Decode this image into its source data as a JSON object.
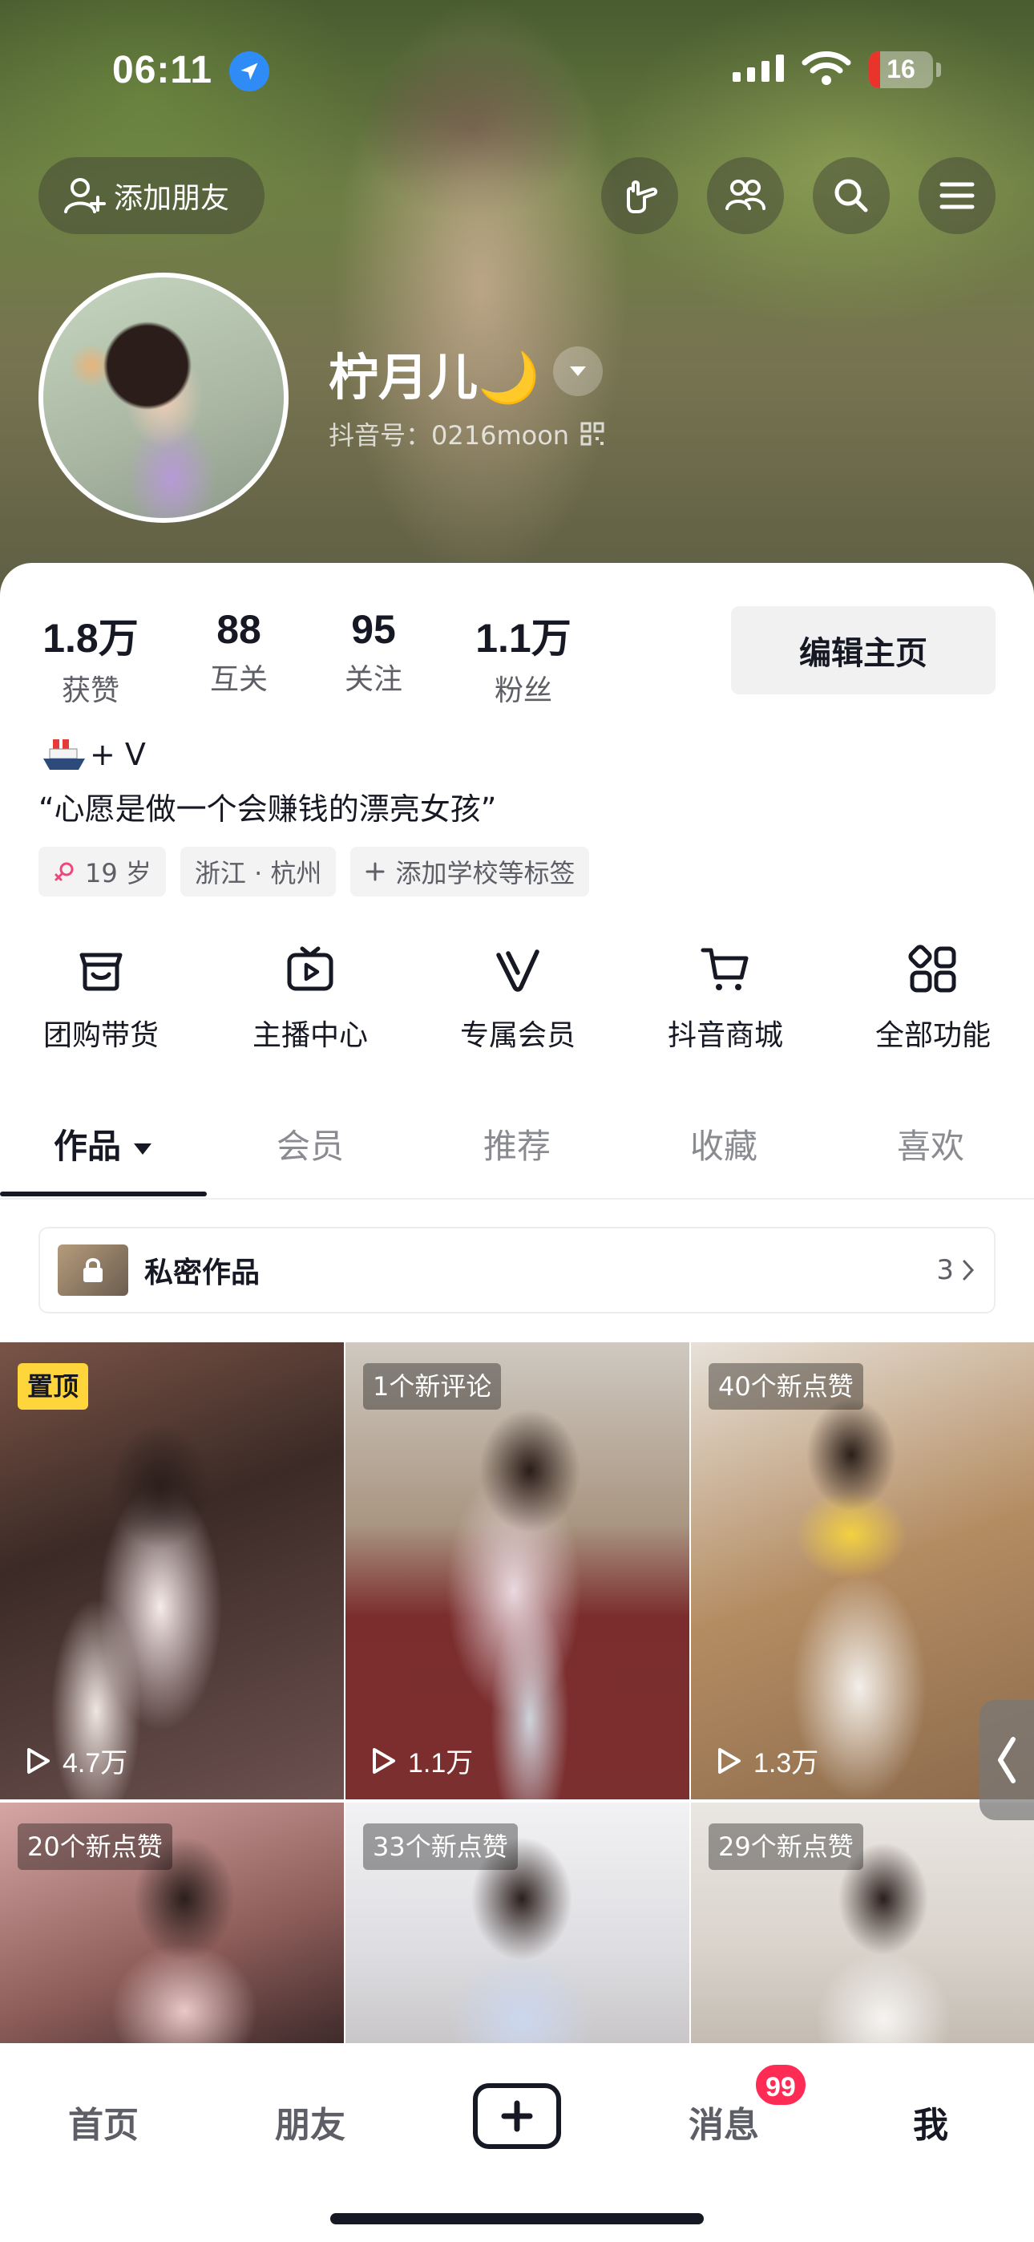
{
  "status_bar": {
    "time": "06:11",
    "battery": "16"
  },
  "header": {
    "add_friend_label": "添加朋友",
    "icons": [
      "hand-point-icon",
      "friends-icon",
      "search-icon",
      "menu-icon"
    ]
  },
  "profile": {
    "nickname": "柠月儿🌙",
    "douyin_id": "抖音号：0216moon"
  },
  "stats": [
    {
      "value": "1.8万",
      "label": "获赞"
    },
    {
      "value": "88",
      "label": "互关"
    },
    {
      "value": "95",
      "label": "关注"
    },
    {
      "value": "1.1万",
      "label": "粉丝"
    }
  ],
  "edit_button": "编辑主页",
  "bio": {
    "line1": "+ V",
    "line2": "“心愿是做一个会赚钱的漂亮女孩”"
  },
  "tags": [
    {
      "icon": "female-icon",
      "text": "19 岁"
    },
    {
      "icon": "",
      "text": "浙江 · 杭州"
    },
    {
      "icon": "plus-icon",
      "text": "添加学校等标签"
    }
  ],
  "features": [
    {
      "icon": "shop-bag-icon",
      "label": "团购带货"
    },
    {
      "icon": "live-tv-icon",
      "label": "主播中心"
    },
    {
      "icon": "v-member-icon",
      "label": "专属会员"
    },
    {
      "icon": "cart-icon",
      "label": "抖音商城"
    },
    {
      "icon": "apps-grid-icon",
      "label": "全部功能"
    }
  ],
  "tabs": [
    "作品",
    "会员",
    "推荐",
    "收藏",
    "喜欢"
  ],
  "private_works": {
    "label": "私密作品",
    "count": "3"
  },
  "videos": [
    {
      "badge": "置顶",
      "badge_type": "pinned",
      "plays": "4.7万"
    },
    {
      "badge": "1个新评论",
      "badge_type": "info",
      "plays": "1.1万"
    },
    {
      "badge": "40个新点赞",
      "badge_type": "info",
      "plays": "1.3万"
    },
    {
      "badge": "20个新点赞",
      "badge_type": "info",
      "plays": ""
    },
    {
      "badge": "33个新点赞",
      "badge_type": "info",
      "plays": ""
    },
    {
      "badge": "29个新点赞",
      "badge_type": "info",
      "plays": ""
    }
  ],
  "bottom_nav": {
    "items": [
      "首页",
      "朋友",
      "消息",
      "我"
    ],
    "message_badge": "99"
  },
  "colors": {
    "accent": "#fe2c55",
    "pinned": "#fed53b",
    "text": "#161823"
  }
}
